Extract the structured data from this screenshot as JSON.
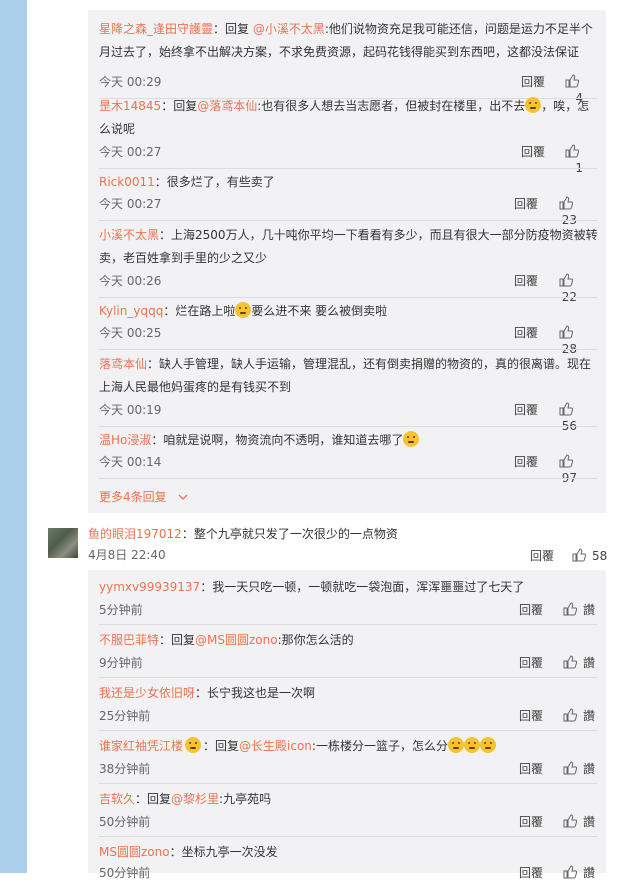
{
  "replies_top": [
    {
      "user": "星降之森_逢田守護靈",
      "prefix": "：回复 ",
      "mention": "@小溪不太黑",
      "text": ":他们说物资充足我可能还信，问题是运力不足半个月过去了，始终拿不出解决方案，不求免费资源，起码花钱得能买到东西吧，这都没法保证",
      "time": "今天 00:29",
      "reply": "回覆",
      "likes": "4"
    },
    {
      "user": "昰木14845",
      "prefix": "：回复",
      "mention": "@落鸢本仙",
      "text": ":也有很多人想去当志愿者，但被封在楼里，出不去",
      "text2": "，唉，怎么说呢",
      "time": "今天 00:27",
      "reply": "回覆",
      "likes": "1"
    },
    {
      "user": "Rick0011",
      "prefix": "：",
      "mention": "",
      "text": "很多烂了，有些卖了",
      "time": "今天 00:27",
      "reply": "回覆",
      "likes": "23"
    },
    {
      "user": "小溪不太黑",
      "prefix": "：",
      "mention": "",
      "text": "上海2500万人，几十吨你平均一下看看有多少，而且有很大一部分防疫物资被转卖，老百姓拿到手里的少之又少",
      "time": "今天 00:26",
      "reply": "回覆",
      "likes": "22"
    },
    {
      "user": "Kylin_yqqq",
      "prefix": "：",
      "mention": "",
      "text": "烂在路上啦",
      "text2": "要么进不来 要么被倒卖啦",
      "time": "今天 00:25",
      "reply": "回覆",
      "likes": "28"
    },
    {
      "user": "落鸢本仙",
      "prefix": "：",
      "mention": "",
      "text": "缺人手管理，缺人手运输，管理混乱，还有倒卖捐赠的物资的，真的很离谱。现在上海人民最他妈蛋疼的是有钱买不到",
      "time": "今天 00:19",
      "reply": "回覆",
      "likes": "56"
    },
    {
      "user": "温Ho浸淑",
      "prefix": "：",
      "mention": "",
      "text": "咱就是说啊，物资流向不透明，谁知道去哪了",
      "time": "今天 00:14",
      "reply": "回覆",
      "likes": "97"
    }
  ],
  "more_replies": "更多4条回复",
  "main_comment": {
    "user": "鱼的眼泪197012",
    "text": "：整个九亭就只发了一次很少的一点物资",
    "time": "4月8日 22:40",
    "reply": "回覆",
    "likes": "58"
  },
  "replies_bottom": [
    {
      "user": "yymxv99939137",
      "prefix": "：",
      "mention": "",
      "text": "我一天只吃一顿，一顿就吃一袋泡面，浑浑噩噩过了七天了",
      "time": "5分钟前",
      "reply": "回覆",
      "likes": "讚"
    },
    {
      "user": "不服巴菲特",
      "prefix": "：回复",
      "mention": "@MS圆圆zono",
      "text": ":那你怎么活的",
      "time": "9分钟前",
      "reply": "回覆",
      "likes": "讚"
    },
    {
      "user": "我还是少女依旧呀",
      "prefix": "：",
      "mention": "",
      "text": "长宁我这也是一次啊",
      "time": "25分钟前",
      "reply": "回覆",
      "likes": "讚"
    },
    {
      "user": "谁家红袖凭江楼",
      "prefix": "：回复",
      "mention": "@长生殿icon",
      "text": ":一栋楼分一篮子，怎么分",
      "time": "38分钟前",
      "reply": "回覆",
      "likes": "讚"
    },
    {
      "user": "吉软久",
      "prefix": "：回复",
      "mention": "@黎杉里",
      "text": ":九亭苑吗",
      "time": "50分钟前",
      "reply": "回覆",
      "likes": "讚"
    },
    {
      "user": "MS圆圆zono",
      "prefix": "：",
      "mention": "",
      "text": "坐标九亭一次没发",
      "time": "50分钟前",
      "reply": "回覆",
      "likes": "讚"
    }
  ],
  "colors": {
    "accent": "#eb7350",
    "reply_bg": "#f2f2f5",
    "left_strip": "#a9cfea"
  }
}
